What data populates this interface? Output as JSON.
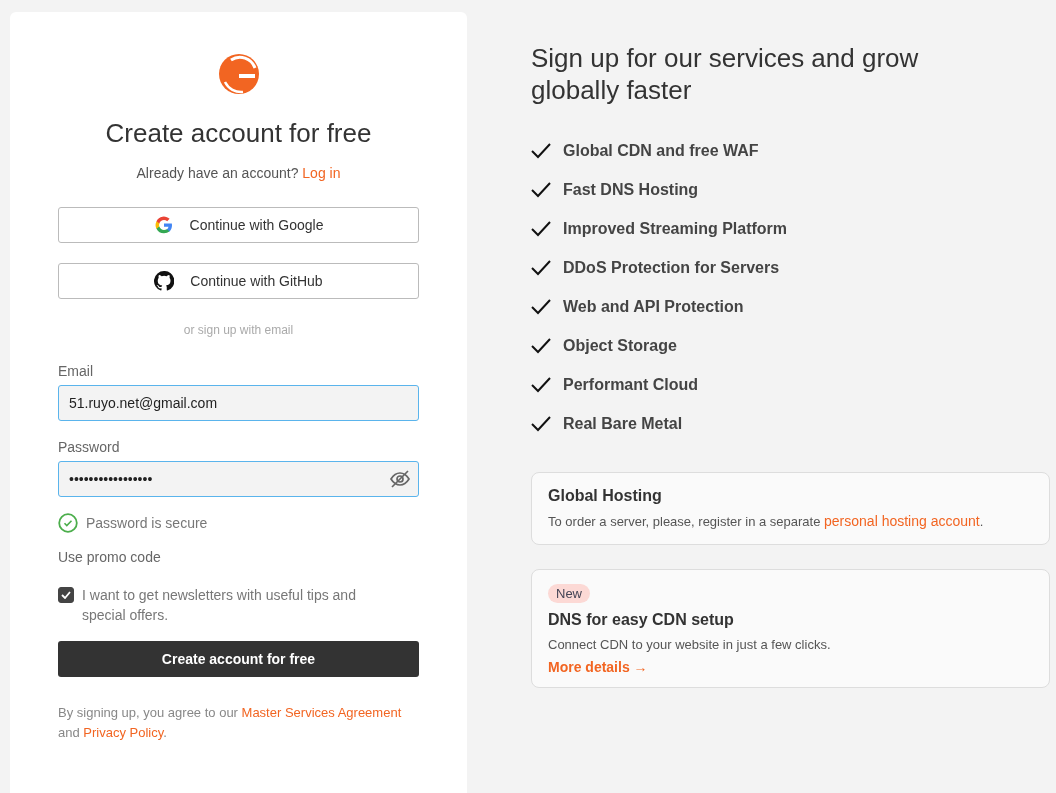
{
  "signup": {
    "title": "Create account for free",
    "login_prompt": {
      "text": "Already have an account?",
      "link": "Log in"
    },
    "social_buttons": [
      {
        "kind": "google",
        "label": "Continue with Google"
      },
      {
        "kind": "github",
        "label": "Continue with GitHub"
      }
    ],
    "divider_text": "or sign up with email",
    "email": {
      "label": "Email",
      "value": "51.ruyo.net@gmail.com"
    },
    "password": {
      "label": "Password",
      "value": "•••••••••••••••••"
    },
    "password_status": "Password is secure",
    "promo_link": "Use promo code",
    "newsletter": {
      "label": "I want to get newsletters with useful tips and special offers.",
      "checked": true
    },
    "submit": "Create account for free",
    "terms": [
      {
        "kind": "text",
        "text": "By signing up, you agree to our "
      },
      {
        "kind": "link",
        "text": "Master Services Agreement"
      },
      {
        "kind": "text",
        "text": " and "
      },
      {
        "kind": "link",
        "text": "Privacy Policy"
      },
      {
        "kind": "text",
        "text": "."
      }
    ]
  },
  "promo": {
    "heading": "Sign up for our services and grow globally faster",
    "features": [
      "Global CDN and free WAF",
      "Fast DNS Hosting",
      "Improved Streaming Platform",
      "DDoS Protection for Servers",
      "Web and API Protection",
      "Object Storage",
      "Performant Cloud",
      "Real Bare Metal"
    ],
    "cards": [
      {
        "title": "Global Hosting",
        "text": [
          {
            "kind": "text",
            "text": "To order a server, please, register in a separate "
          },
          {
            "kind": "link",
            "text": "personal hosting account"
          },
          {
            "kind": "text",
            "text": "."
          }
        ]
      },
      {
        "badge": "New",
        "title": "DNS for easy CDN setup",
        "text": [
          {
            "kind": "text",
            "text": "Connect CDN to your website in just a few clicks."
          }
        ],
        "link": "More details →"
      }
    ]
  }
}
